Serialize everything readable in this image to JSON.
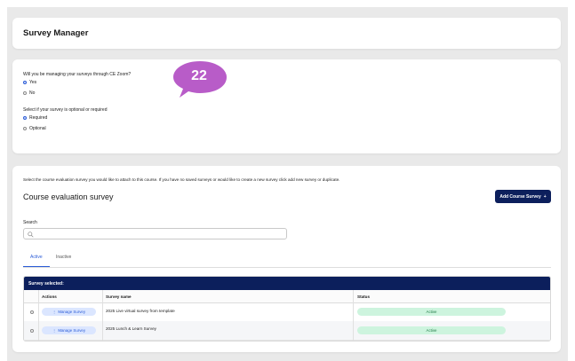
{
  "header": {
    "title": "Survey Manager"
  },
  "settings": {
    "manage_question": "Will you be managing your surveys through CE Zoom?",
    "manage_options": [
      {
        "label": "Yes",
        "selected": true
      },
      {
        "label": "No",
        "selected": false
      }
    ],
    "required_question": "Select if your survey is optional or required",
    "required_options": [
      {
        "label": "Required",
        "selected": true
      },
      {
        "label": "Optional",
        "selected": false
      }
    ]
  },
  "annotation": {
    "number": "22",
    "color": "#b85cc8"
  },
  "course_survey": {
    "intro": "Select the course evaluation survey you would like to attach to this course. If you have no saved surveys or would like to create a new survey click add new survey or duplicate.",
    "title": "Course evaluation survey",
    "add_button": "Add Course Survey",
    "add_button_icon": "+",
    "search_label": "Search",
    "search_placeholder": "",
    "tabs": [
      {
        "label": "Active",
        "active": true
      },
      {
        "label": "Inactive",
        "active": false
      }
    ],
    "table": {
      "selected_label": "Survey selected:",
      "columns": [
        "Actions",
        "Survey name",
        "Status"
      ],
      "rows": [
        {
          "action": "Manage Survey",
          "name": "2025 Live virtual survey from template",
          "status": "Active"
        },
        {
          "action": "Manage Survey",
          "name": "2025 Lunch & Learn Survey",
          "status": "Active"
        }
      ]
    }
  },
  "colors": {
    "navy": "#0c1f5c",
    "accent": "#2a5bd7",
    "status_bg": "#cdf4de",
    "status_text": "#1f7a45"
  }
}
